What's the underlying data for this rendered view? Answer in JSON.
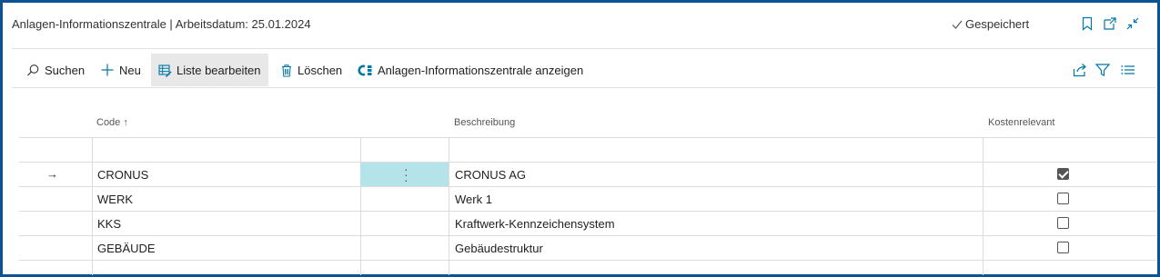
{
  "header": {
    "title": "Anlagen-Informationszentrale | Arbeitsdatum: 25.01.2024",
    "saved_label": "Gespeichert"
  },
  "actions": {
    "search": "Suchen",
    "new": "Neu",
    "edit_list": "Liste bearbeiten",
    "delete": "Löschen",
    "show_center": "Anlagen-Informationszentrale anzeigen"
  },
  "table": {
    "columns": {
      "code": "Code ↑",
      "description": "Beschreibung",
      "cost_relevant": "Kostenrelevant"
    },
    "rows": [
      {
        "code": "CRONUS",
        "description": "CRONUS AG",
        "cost_relevant": true
      },
      {
        "code": "WERK",
        "description": "Werk 1",
        "cost_relevant": false
      },
      {
        "code": "KKS",
        "description": "Kraftwerk-Kennzeichensystem",
        "cost_relevant": false
      },
      {
        "code": "GEBÄUDE",
        "description": "Gebäudestruktur",
        "cost_relevant": false
      }
    ]
  },
  "colors": {
    "frame": "#0b5394",
    "accent": "#0078a8",
    "selected_cell": "#b4e4ea"
  },
  "icons": [
    "check-icon",
    "bookmark-icon",
    "open-new-window-icon",
    "collapse-icon",
    "search-icon",
    "plus-icon",
    "edit-list-icon",
    "trash-icon",
    "info-center-icon",
    "share-icon",
    "filter-icon",
    "list-icon",
    "arrow-right-icon",
    "more-options-icon"
  ]
}
